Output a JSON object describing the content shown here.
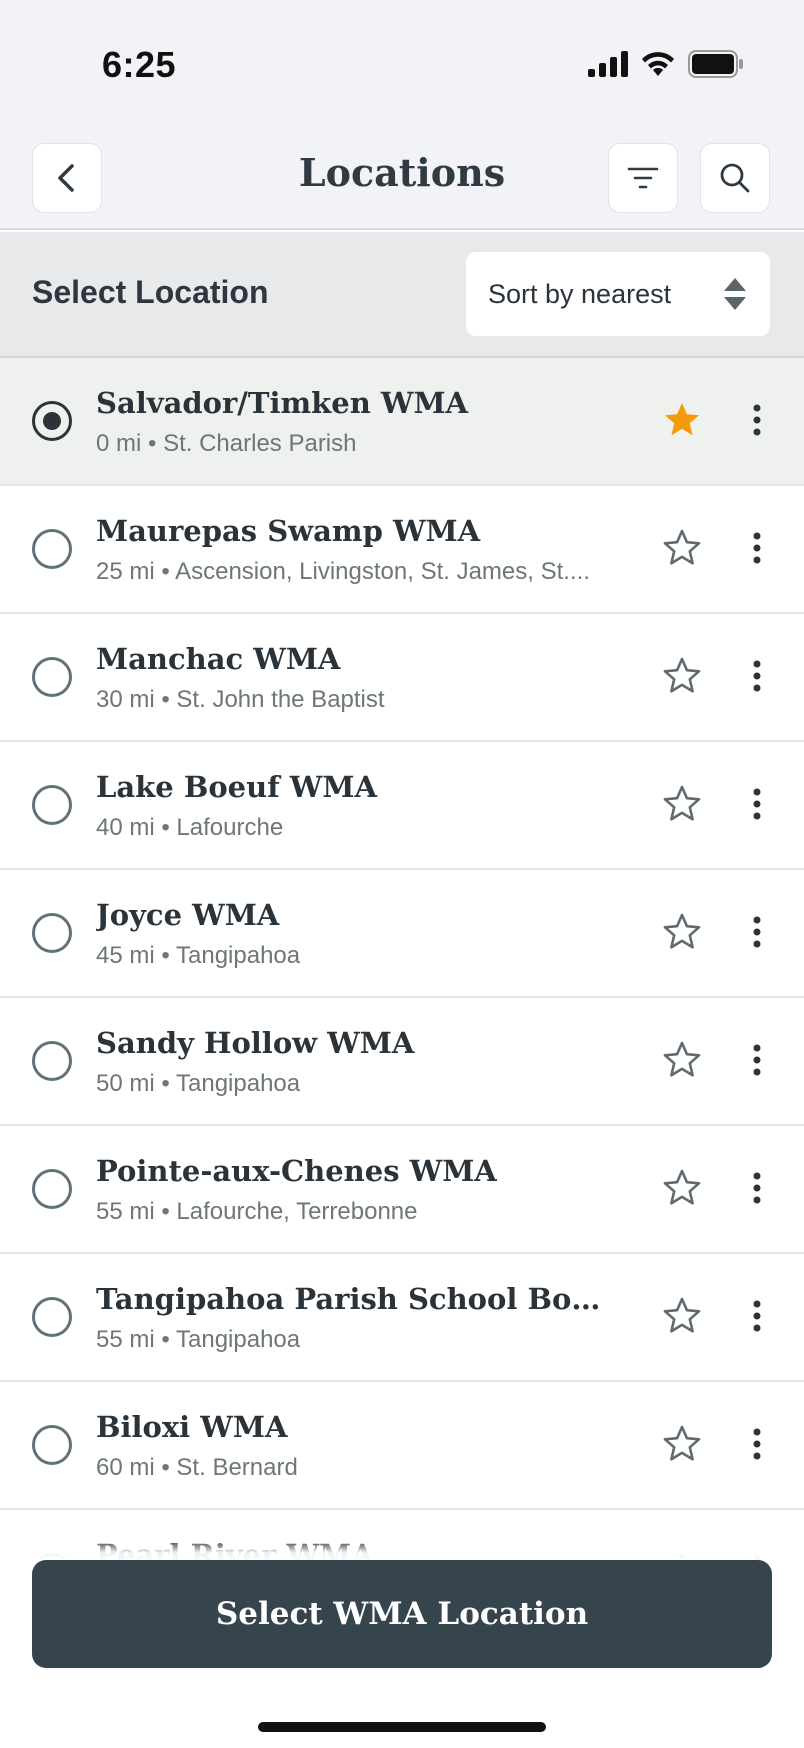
{
  "status_bar": {
    "time": "6:25"
  },
  "nav": {
    "title": "Locations",
    "back_icon": "chevron-left-icon",
    "filter_icon": "filter-icon",
    "search_icon": "search-icon"
  },
  "sub_header": {
    "title": "Select Location",
    "sort_label": "Sort by nearest"
  },
  "colors": {
    "accent_star": "#f59a0b",
    "cta_bg": "#36444d",
    "selected_row_bg": "#eef1ee"
  },
  "locations": [
    {
      "name": "Salvador/Timken WMA",
      "subtitle": "0 mi • St. Charles Parish",
      "selected": true,
      "favorite": true
    },
    {
      "name": "Maurepas Swamp WMA",
      "subtitle": "25 mi • Ascension, Livingston, St. James, St....",
      "selected": false,
      "favorite": false
    },
    {
      "name": "Manchac WMA",
      "subtitle": "30 mi • St. John the Baptist",
      "selected": false,
      "favorite": false
    },
    {
      "name": "Lake Boeuf WMA",
      "subtitle": "40 mi • Lafourche",
      "selected": false,
      "favorite": false
    },
    {
      "name": "Joyce WMA",
      "subtitle": "45 mi • Tangipahoa",
      "selected": false,
      "favorite": false
    },
    {
      "name": "Sandy Hollow WMA",
      "subtitle": "50 mi • Tangipahoa",
      "selected": false,
      "favorite": false
    },
    {
      "name": "Pointe-aux-Chenes WMA",
      "subtitle": "55 mi • Lafourche, Terrebonne",
      "selected": false,
      "favorite": false
    },
    {
      "name": "Tangipahoa Parish School Board W...",
      "subtitle": "55 mi • Tangipahoa",
      "selected": false,
      "favorite": false
    },
    {
      "name": "Biloxi WMA",
      "subtitle": "60 mi • St. Bernard",
      "selected": false,
      "favorite": false
    },
    {
      "name": "Pearl River WMA",
      "subtitle": "",
      "selected": false,
      "favorite": false
    }
  ],
  "cta": {
    "label": "Select WMA Location"
  }
}
